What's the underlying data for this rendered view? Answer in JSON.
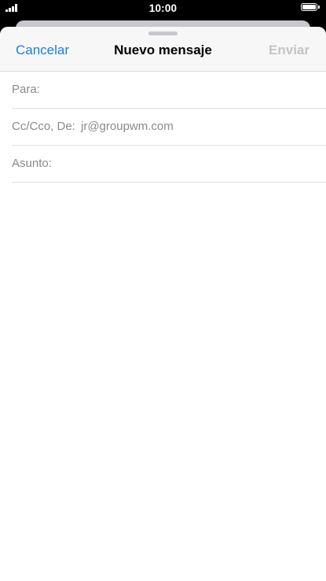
{
  "status_bar": {
    "time": "10:00",
    "signal_icon": "signal-bars-icon",
    "battery_icon": "battery-full-icon",
    "battery_level": 1.0
  },
  "compose": {
    "title": "Nuevo mensaje",
    "cancel_label": "Cancelar",
    "send_label": "Enviar",
    "colors": {
      "accent": "#1e7fd6",
      "send_disabled": "#c4c4c6",
      "label": "#8a8a8e"
    },
    "fields": {
      "to": {
        "label": "Para:",
        "value": ""
      },
      "cc": {
        "label": "Cc/Cco, De:",
        "value": "jr@groupwm.com"
      },
      "subject": {
        "label": "Asunto:",
        "value": ""
      }
    },
    "body": ""
  }
}
